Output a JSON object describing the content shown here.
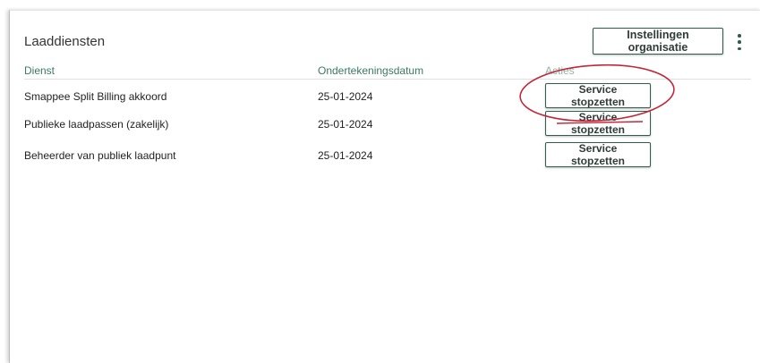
{
  "panel": {
    "title": "Laaddiensten",
    "settings_button": "Instellingen organisatie",
    "more_icon": "kebab-vertical-icon"
  },
  "table": {
    "headers": {
      "service": "Dienst",
      "date": "Ondertekeningsdatum",
      "actions": "Acties"
    },
    "rows": [
      {
        "service": "Smappee Split Billing akkoord",
        "date": "25-01-2024",
        "action": "Service stopzetten"
      },
      {
        "service": "Publieke laadpassen (zakelijk)",
        "date": "25-01-2024",
        "action": "Service stopzetten"
      },
      {
        "service": "Beheerder van publiek laadpunt",
        "date": "25-01-2024",
        "action": "Service stopzetten"
      }
    ]
  },
  "colors": {
    "accent": "#2f5d50",
    "header_text": "#3a7a62",
    "annotation": "#c0283a"
  }
}
